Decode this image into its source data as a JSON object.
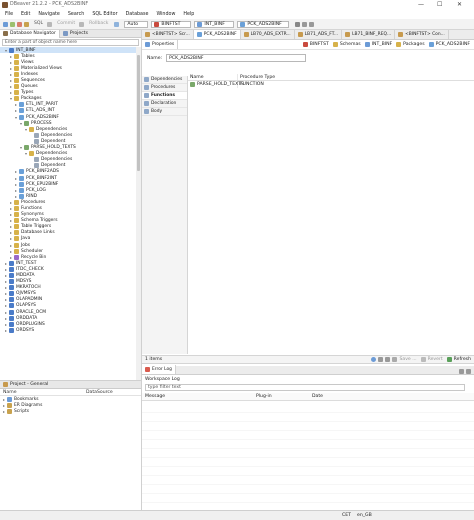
{
  "window": {
    "title": "DBeaver 21.2.2 - PCK_ADS2BINF",
    "min": "—",
    "max": "☐",
    "close": "✕"
  },
  "menu": [
    "File",
    "Edit",
    "Navigate",
    "Search",
    "SQL Editor",
    "Database",
    "Window",
    "Help"
  ],
  "toolbar": {
    "sql": "SQL",
    "commit": "Commit",
    "rollback": "Rollback",
    "mode": "Auto",
    "conn": "BINFTST",
    "schema": "INT_BINF",
    "object": "PCK_ADS2BINF"
  },
  "navigator": {
    "tabs": [
      "Database Navigator",
      "Projects"
    ],
    "filter_placeholder": "Enter a part of object name here",
    "tree": [
      {
        "d": 1,
        "t": "▾",
        "c": "#4a7bc8",
        "label": "INT_BINF",
        "sel": true
      },
      {
        "d": 2,
        "t": "▸",
        "c": "#d7b24a",
        "label": "Tables"
      },
      {
        "d": 2,
        "t": "▸",
        "c": "#d7b24a",
        "label": "Views"
      },
      {
        "d": 2,
        "t": "▸",
        "c": "#d7b24a",
        "label": "Materialized Views"
      },
      {
        "d": 2,
        "t": "▸",
        "c": "#d7b24a",
        "label": "Indexes"
      },
      {
        "d": 2,
        "t": "▸",
        "c": "#d7b24a",
        "label": "Sequences"
      },
      {
        "d": 2,
        "t": "▸",
        "c": "#d7b24a",
        "label": "Queues"
      },
      {
        "d": 2,
        "t": "▸",
        "c": "#d7b24a",
        "label": "Types"
      },
      {
        "d": 2,
        "t": "▾",
        "c": "#d7b24a",
        "label": "Packages"
      },
      {
        "d": 3,
        "t": "▸",
        "c": "#6aa0d8",
        "label": "ETL_INT_PARIT"
      },
      {
        "d": 3,
        "t": "▸",
        "c": "#6aa0d8",
        "label": "ETL_ADS_INT"
      },
      {
        "d": 3,
        "t": "▾",
        "c": "#6aa0d8",
        "label": "PCK_ADS2BINF"
      },
      {
        "d": 4,
        "t": "▾",
        "c": "#7aa86a",
        "label": "PROCESS"
      },
      {
        "d": 5,
        "t": "▾",
        "c": "#d7b24a",
        "label": "Dependencies"
      },
      {
        "d": 6,
        "t": "",
        "c": "#9aa7b8",
        "label": "Dependencies"
      },
      {
        "d": 6,
        "t": "",
        "c": "#9aa7b8",
        "label": "Dependent"
      },
      {
        "d": 4,
        "t": "▾",
        "c": "#7aa86a",
        "label": "PARSE_HOLD_TEXTS"
      },
      {
        "d": 5,
        "t": "▾",
        "c": "#d7b24a",
        "label": "Dependencies"
      },
      {
        "d": 6,
        "t": "",
        "c": "#9aa7b8",
        "label": "Dependencies"
      },
      {
        "d": 6,
        "t": "",
        "c": "#9aa7b8",
        "label": "Dependent"
      },
      {
        "d": 3,
        "t": "▸",
        "c": "#6aa0d8",
        "label": "PCK_BINF2ADS"
      },
      {
        "d": 3,
        "t": "▸",
        "c": "#6aa0d8",
        "label": "PCK_BINF2INT"
      },
      {
        "d": 3,
        "t": "▸",
        "c": "#6aa0d8",
        "label": "PCK_EPU2BINF"
      },
      {
        "d": 3,
        "t": "▸",
        "c": "#6aa0d8",
        "label": "PCK_LOG"
      },
      {
        "d": 3,
        "t": "▸",
        "c": "#6aa0d8",
        "label": "RIND"
      },
      {
        "d": 2,
        "t": "▸",
        "c": "#d7b24a",
        "label": "Procedures"
      },
      {
        "d": 2,
        "t": "▸",
        "c": "#d7b24a",
        "label": "Functions"
      },
      {
        "d": 2,
        "t": "▸",
        "c": "#d7b24a",
        "label": "Synonyms"
      },
      {
        "d": 2,
        "t": "▸",
        "c": "#d7b24a",
        "label": "Schema Triggers"
      },
      {
        "d": 2,
        "t": "▸",
        "c": "#d7b24a",
        "label": "Table Triggers"
      },
      {
        "d": 2,
        "t": "▸",
        "c": "#d7b24a",
        "label": "Database Links"
      },
      {
        "d": 2,
        "t": "▸",
        "c": "#d7b24a",
        "label": "Java"
      },
      {
        "d": 2,
        "t": "▸",
        "c": "#d7b24a",
        "label": "Jobs"
      },
      {
        "d": 2,
        "t": "▸",
        "c": "#d7b24a",
        "label": "Scheduler"
      },
      {
        "d": 2,
        "t": "▸",
        "c": "#9a6ac8",
        "label": "Recycle Bin"
      },
      {
        "d": 1,
        "t": "▸",
        "c": "#4a7bc8",
        "label": "INT_TEST"
      },
      {
        "d": 1,
        "t": "▸",
        "c": "#4a7bc8",
        "label": "ITDC_CHECK"
      },
      {
        "d": 1,
        "t": "▸",
        "c": "#4a7bc8",
        "label": "MDDATA"
      },
      {
        "d": 1,
        "t": "▸",
        "c": "#4a7bc8",
        "label": "MDSYS"
      },
      {
        "d": 1,
        "t": "▸",
        "c": "#4a7bc8",
        "label": "MKRATOCH"
      },
      {
        "d": 1,
        "t": "▸",
        "c": "#4a7bc8",
        "label": "OJVMSYS"
      },
      {
        "d": 1,
        "t": "▸",
        "c": "#4a7bc8",
        "label": "OLAPADMIN"
      },
      {
        "d": 1,
        "t": "▸",
        "c": "#4a7bc8",
        "label": "OLAPSYS"
      },
      {
        "d": 1,
        "t": "▸",
        "c": "#4a7bc8",
        "label": "ORACLE_OCM"
      },
      {
        "d": 1,
        "t": "▸",
        "c": "#4a7bc8",
        "label": "ORDDATA"
      },
      {
        "d": 1,
        "t": "▸",
        "c": "#4a7bc8",
        "label": "ORDPLUGINS"
      },
      {
        "d": 1,
        "t": "▸",
        "c": "#4a7bc8",
        "label": "ORDSYS"
      }
    ]
  },
  "project": {
    "title": "Project - General",
    "cols": [
      "Name",
      "DataSource"
    ],
    "items": [
      "Bookmarks",
      "ER Diagrams",
      "Scripts"
    ]
  },
  "editor": {
    "tabs": [
      "<BINFTST> Scr...",
      "PCK_ADS2BINF",
      "LB70_ADS_EXTR...",
      "LB71_ADS_FT...",
      "LB71_BINF_REQ...",
      "<BINFTST> Con..."
    ],
    "properties_tab": "Properties",
    "crumbs": [
      "BINFTST",
      "Schemas",
      "INT_BINF",
      "Packages",
      "PCK_ADS2BINF"
    ],
    "name_label": "Name:",
    "name_value": "PCK_ADS2BINF",
    "side_tabs": [
      "Dependencies",
      "Procedures",
      "Functions",
      "Declaration",
      "Body"
    ],
    "active_side": 2,
    "grid_cols": [
      "Name",
      "Procedure Type"
    ],
    "grid_rows": [
      [
        "PARSE_HOLD_TEXTS",
        "FUNCTION"
      ]
    ],
    "items_count": "1 items",
    "save": "Save ...",
    "revert": "Revert",
    "refresh": "Refresh"
  },
  "log": {
    "tabs": [
      "Error Log"
    ],
    "workspace": "Workspace Log",
    "filter_placeholder": "type filter text",
    "cols": [
      "Message",
      "Plug-in",
      "Date"
    ]
  },
  "status": {
    "tz": "CET",
    "locale": "en_GB"
  }
}
